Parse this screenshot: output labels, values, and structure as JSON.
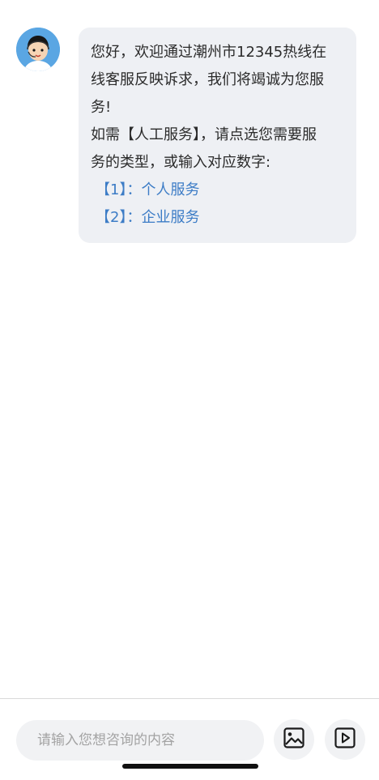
{
  "chat": {
    "messages": [
      {
        "sender": "agent",
        "lines": [
          "您好，欢迎通过潮州市12345热线在",
          "线客服反映诉求，我们将竭诚为您服",
          "务!",
          "如需【人工服务】，请点选您需要服",
          "务的类型，或输入对应数字:"
        ],
        "options": [
          "【1】：个人服务",
          "【2】：企业服务"
        ]
      }
    ]
  },
  "composer": {
    "placeholder": "请输入您想咨询的内容",
    "icons": {
      "image": "image-icon",
      "video": "play-icon"
    }
  },
  "colors": {
    "bubble_bg": "#eef0f4",
    "option_link": "#3c7cc6",
    "avatar_bg": "#5aa6e3"
  }
}
